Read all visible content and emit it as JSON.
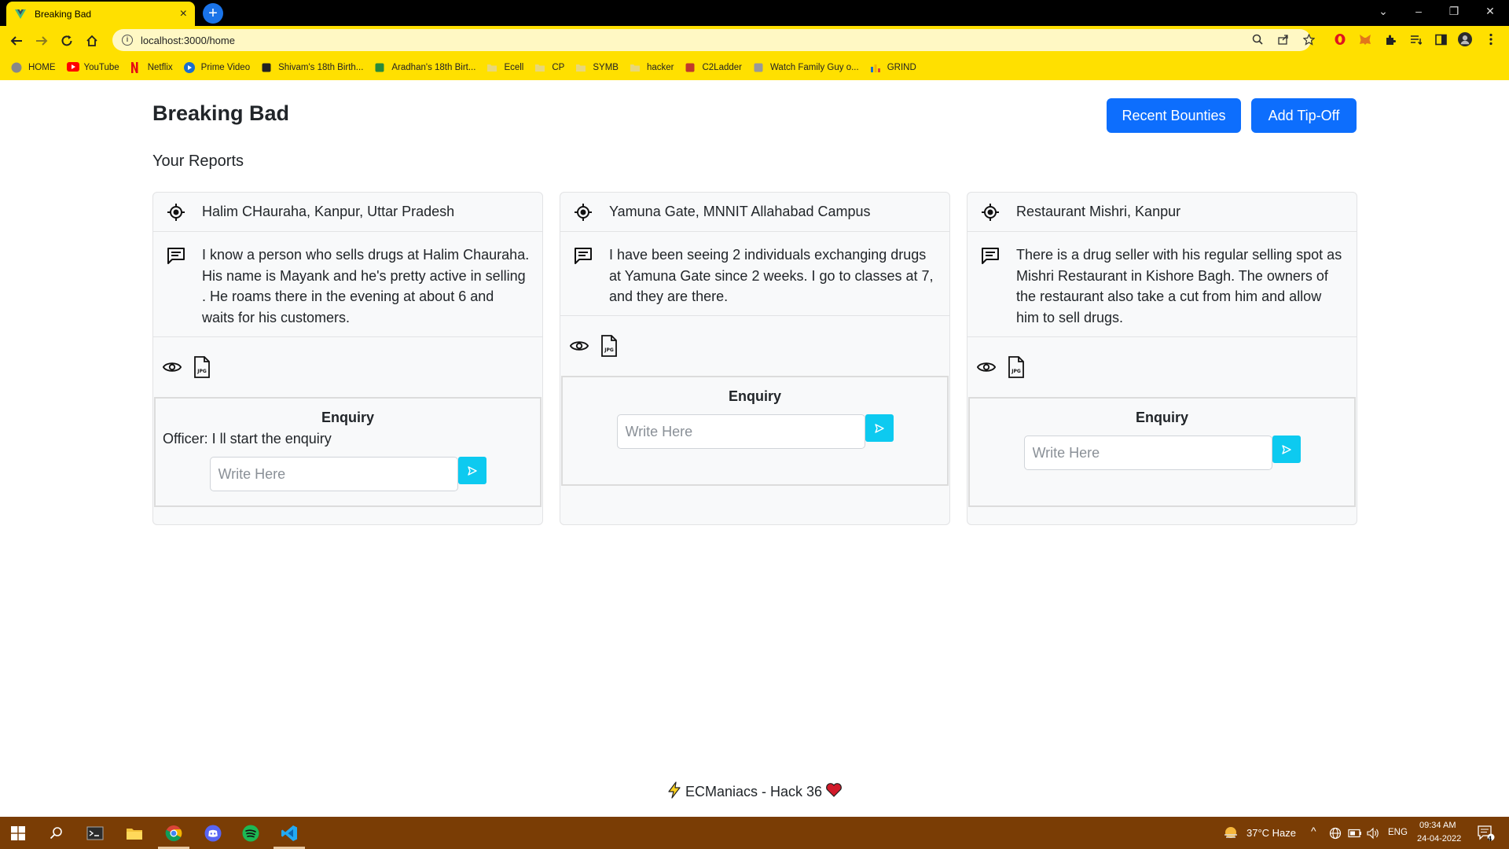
{
  "browser": {
    "tab_title": "Breaking Bad",
    "tab_close": "×",
    "new_tab": "+",
    "url": "localhost:3000/home",
    "bookmarks": [
      {
        "label": "HOME",
        "icon": "globe-icon",
        "color": "#888888"
      },
      {
        "label": "YouTube",
        "icon": "youtube-icon",
        "color": "#ff0000"
      },
      {
        "label": "Netflix",
        "icon": "netflix-icon",
        "color": "#e50914"
      },
      {
        "label": "Prime Video",
        "icon": "prime-video-icon",
        "color": "#1a6ecf"
      },
      {
        "label": "Shivam's 18th Birth...",
        "icon": "page-icon",
        "color": "#222222"
      },
      {
        "label": "Aradhan's 18th Birt...",
        "icon": "page-icon",
        "color": "#2a8a3a"
      },
      {
        "label": "Ecell",
        "icon": "folder-icon",
        "color": "#e8d77a"
      },
      {
        "label": "CP",
        "icon": "folder-icon",
        "color": "#e8d77a"
      },
      {
        "label": "SYMB",
        "icon": "folder-icon",
        "color": "#e8d77a"
      },
      {
        "label": "hacker",
        "icon": "folder-icon",
        "color": "#e8d77a"
      },
      {
        "label": "C2Ladder",
        "icon": "page-icon",
        "color": "#c0392b"
      },
      {
        "label": "Watch Family Guy o...",
        "icon": "page-icon",
        "color": "#999999"
      },
      {
        "label": "GRIND",
        "icon": "chart-icon",
        "color": "#1a6ecf"
      }
    ]
  },
  "app": {
    "brand": "Breaking Bad",
    "buttons": {
      "recent_bounties": "Recent Bounties",
      "add_tipoff": "Add Tip-Off"
    },
    "section_title": "Your Reports",
    "reports": [
      {
        "location": "Halim CHauraha, Kanpur, Uttar Pradesh",
        "description": "I know a person who sells drugs at Halim Chauraha. His name is Mayank and he's pretty active in selling . He roams there in the evening at about 6 and waits for his customers.",
        "enquiry_title": "Enquiry",
        "enquiry_message": "Officer: I ll start the enquiry",
        "placeholder": "Write Here"
      },
      {
        "location": "Yamuna Gate, MNNIT Allahabad Campus",
        "description": "I have been seeing 2 individuals exchanging drugs at Yamuna Gate since 2 weeks. I go to classes at 7, and they are there.",
        "enquiry_title": "Enquiry",
        "enquiry_message": "",
        "placeholder": "Write Here"
      },
      {
        "location": "Restaurant Mishri, Kanpur",
        "description": "There is a drug seller with his regular selling spot as Mishri Restaurant in Kishore Bagh. The owners of the restaurant also take a cut from him and allow him to sell drugs.",
        "enquiry_title": "Enquiry",
        "enquiry_message": "",
        "placeholder": "Write Here"
      }
    ],
    "footer": "ECManiacs - Hack 36"
  },
  "taskbar": {
    "weather": "37°C  Haze",
    "language": "ENG",
    "time": "09:34 AM",
    "date": "24-04-2022",
    "notifications": "4"
  },
  "colors": {
    "chrome_accent": "#ffe000",
    "primary_button": "#0d6efd",
    "send_button": "#0dcaf0",
    "taskbar": "#7a3d05"
  }
}
